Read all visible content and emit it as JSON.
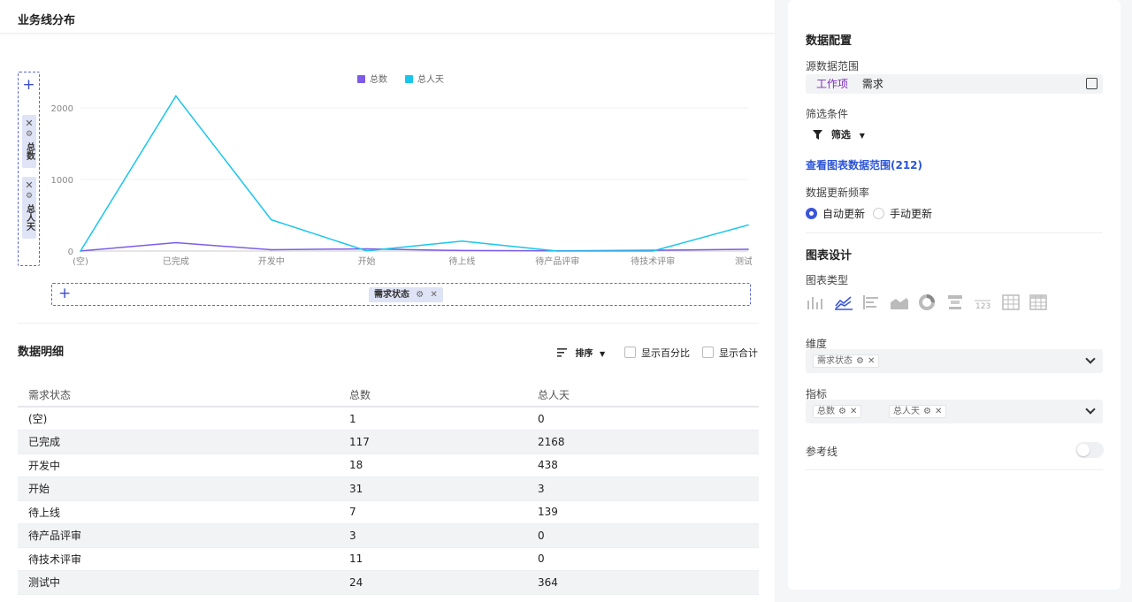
{
  "header": {
    "title": "业务线分布"
  },
  "y_axis_drop": {
    "add": "+",
    "chips": [
      "总数",
      "总人天"
    ],
    "remove": "✕",
    "gear": "⚙"
  },
  "x_axis_drop": {
    "add": "+",
    "chip": "需求状态",
    "remove": "✕",
    "gear": "⚙"
  },
  "colors": {
    "total": "#7c5ce8",
    "person_days": "#18c6ec",
    "accent": "#3a55d9"
  },
  "chart_data": {
    "type": "line",
    "categories": [
      "(空)",
      "已完成",
      "开发中",
      "开始",
      "待上线",
      "待产品评审",
      "待技术评审",
      "测试中"
    ],
    "series": [
      {
        "name": "总数",
        "values": [
          1,
          117,
          18,
          31,
          7,
          3,
          11,
          24
        ]
      },
      {
        "name": "总人天",
        "values": [
          0,
          2168,
          438,
          3,
          139,
          0,
          0,
          364
        ]
      }
    ],
    "yticks": [
      "0",
      "1000",
      "2000"
    ],
    "ylim": [
      0,
      2200
    ],
    "legend": "top-center",
    "grid": true
  },
  "detail": {
    "title": "数据明细",
    "sort_label": "排序",
    "show_percent": "显示百分比",
    "show_total": "显示合计",
    "columns": [
      "需求状态",
      "总数",
      "总人天"
    ],
    "rows": [
      [
        "(空)",
        "1",
        "0"
      ],
      [
        "已完成",
        "117",
        "2168"
      ],
      [
        "开发中",
        "18",
        "438"
      ],
      [
        "开始",
        "31",
        "3"
      ],
      [
        "待上线",
        "7",
        "139"
      ],
      [
        "待产品评审",
        "3",
        "0"
      ],
      [
        "待技术评审",
        "11",
        "0"
      ],
      [
        "测试中",
        "24",
        "364"
      ]
    ]
  },
  "config": {
    "title": "数据配置",
    "source_label": "源数据范围",
    "source_tag": "工作项",
    "source_value": "需求",
    "filter_label": "筛选条件",
    "filter_button": "筛选",
    "view_link": "查看图表数据范围(212)",
    "frequency_label": "数据更新频率",
    "freq_auto": "自动更新",
    "freq_manual": "手动更新"
  },
  "design": {
    "title": "图表设计",
    "type_label": "图表类型",
    "chart_types": [
      "bar-chart-icon",
      "line-chart-icon",
      "horizontal-bar-icon",
      "area-chart-icon",
      "pie-chart-icon",
      "funnel-chart-icon",
      "number-card-icon",
      "table-icon",
      "pivot-table-icon"
    ],
    "dimension_label": "维度",
    "dimension_chip": "需求状态",
    "metric_label": "指标",
    "metric_chips": [
      "总数",
      "总人天"
    ],
    "refline_label": "参考线"
  }
}
